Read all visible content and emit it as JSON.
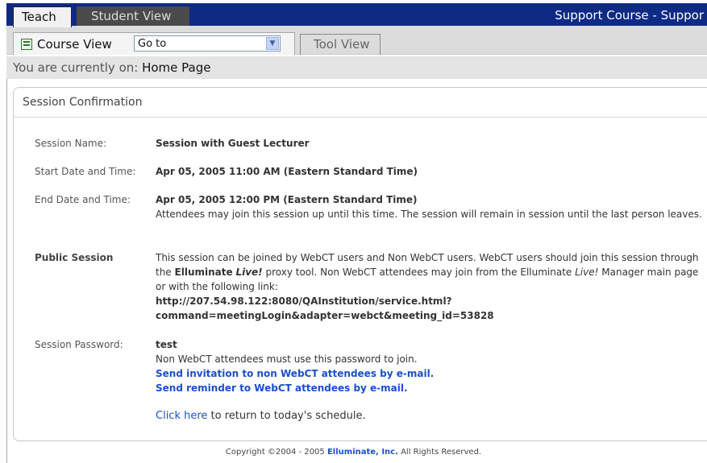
{
  "tabs": {
    "teach": "Teach",
    "student_view": "Student View",
    "course_title": "Support Course - Suppor"
  },
  "nav": {
    "course_view": "Course View",
    "goto_value": "Go to",
    "tool_view": "Tool View"
  },
  "location": {
    "prefix": "You are currently on: ",
    "page": "Home Page"
  },
  "panel": {
    "title": "Session Confirmation",
    "session_name_label": "Session Name:",
    "session_name": "Session with Guest Lecturer",
    "start_label": "Start Date and Time:",
    "start_value": "Apr 05, 2005 11:00 AM (Eastern Standard Time)",
    "end_label": "End Date and Time:",
    "end_value": "Apr 05, 2005 12:00 PM (Eastern Standard Time)",
    "end_note": "Attendees may join this session up until this time. The session will remain in session until the last person leaves.",
    "public_label": "Public Session",
    "public_text_1": "This session can be joined by WebCT users and Non WebCT users. WebCT users should join this session through the ",
    "elluminate": "Elluminate",
    "live": "Live!",
    "public_text_2": " proxy tool. Non WebCT attendees may join from the Elluminate ",
    "public_text_3": " Manager main page or with the following link:",
    "link_line1": "http://207.54.98.122:8080/QAInstitution/service.html?",
    "link_line2": "command=meetingLogin&adapter=webct&meeting_id=53828",
    "password_label": "Session Password:",
    "password_value": "test",
    "password_note": "Non WebCT attendees must use this password to join.",
    "send_invite": "Send invitation to non WebCT attendees by e-mail.",
    "send_reminder": "Send reminder to WebCT attendees by e-mail.",
    "click_here": "Click here",
    "return_text": " to return to today's schedule."
  },
  "footer": {
    "prefix": "Copyright ©2004 - 2005 ",
    "company": "Elluminate, Inc.",
    "suffix": " All Rights Reserved."
  }
}
